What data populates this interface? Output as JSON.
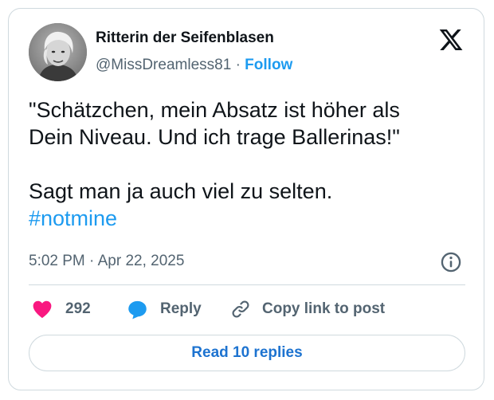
{
  "author": {
    "name": "Ritterin der Seifenblasen",
    "handle": "@MissDreamless81",
    "separator": "·",
    "follow_label": "Follow"
  },
  "tweet": {
    "lines": [
      "\"Schätzchen, mein Absatz ist höher als",
      "Dein Niveau. Und ich trage Ballerinas!\"",
      "",
      "Sagt man ja auch viel zu selten."
    ],
    "hashtag": "#notmine",
    "timestamp": "5:02 PM · Apr 22, 2025"
  },
  "actions": {
    "like_count": "292",
    "reply_label": "Reply",
    "copy_label": "Copy link to post"
  },
  "read_replies_label": "Read 10 replies",
  "icons": {
    "logo": "x-logo-icon",
    "info": "info-icon",
    "like": "heart-icon",
    "reply": "speech-bubble-icon",
    "copy": "link-icon"
  },
  "colors": {
    "accent": "#1d9bf0",
    "like": "#f91880",
    "text": "#0f1419",
    "muted": "#536471",
    "border": "#cfd9de"
  }
}
